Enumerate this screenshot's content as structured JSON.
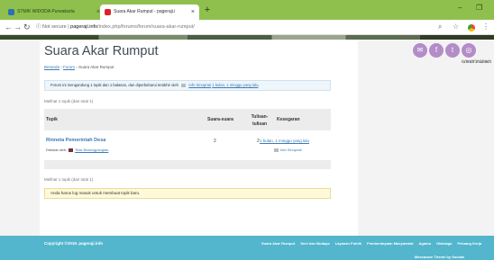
{
  "browser": {
    "tabs": [
      {
        "label": "STMIK WIDODA Purwakarta"
      },
      {
        "label": "Suara Akar Rumput - pageraji.i"
      }
    ],
    "address": {
      "security": "Not secure",
      "domain": "pageraji.info",
      "path": "/index.php/forums/forum/suara-akar-rumput/"
    }
  },
  "page": {
    "title": "Suara Akar Rumput",
    "breadcrumb": {
      "home": "Beranda",
      "forum": "Forum",
      "current": "Suara Akar Rumput",
      "sep": "›"
    },
    "info": {
      "prefix": "Forum ini mengandung 1 topik dan 1 balasan, dan diperbaharui terakhir oleh",
      "user": "Info Sinuprati",
      "time": "1 bulan, 1 minggu yang lalu",
      "suffix": "."
    },
    "viewing_top": "Melihat 1 topik (dari total 1)",
    "viewing_bottom": "Melihat 1 topik (dari total 1)",
    "table": {
      "headers": [
        "Topik",
        "Suara-suara",
        "Tulisan-tulisan",
        "Kesegaran"
      ],
      "rows": [
        {
          "title": "Rinneta Pemerintah Desa",
          "started_by": "Dimulai oleh:",
          "author": "Tilas Bintangpangtas",
          "voices": "2",
          "posts": "2",
          "freshness": "1 bulan, 1 minggu yang lalu",
          "fresh_by": "Info Sinuprati"
        }
      ]
    },
    "notice": "Anda harus log masuk untuk membuat topik baru."
  },
  "social": {
    "icons": [
      "mail-icon",
      "facebook-icon",
      "twitter-icon",
      "instagram-icon"
    ],
    "tagline": "ꦲꦏꦫꦕꦏ"
  },
  "footer": {
    "copyright": "Copyright ©2019. pageraji.info",
    "links": [
      "Suara Akar Rumput",
      "Seni dan Budaya",
      "Layanan Publik",
      "Pemberdayaan Masyarakat",
      "Agama",
      "Olahraga",
      "Peluang Kerja"
    ],
    "theme": "Meezacare Theme by Socials"
  },
  "colors": {
    "chrome": "#8fc04e",
    "footer": "#53b6cd",
    "link": "#3a7ab5",
    "social": "#b48cc8"
  }
}
